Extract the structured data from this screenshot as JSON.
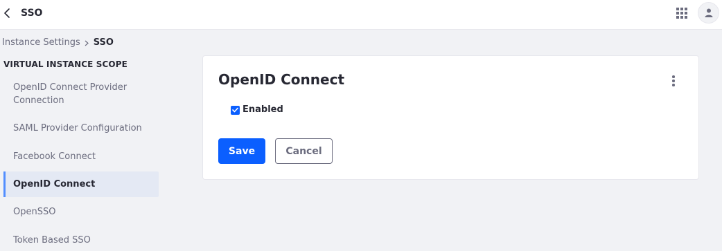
{
  "header": {
    "title": "SSO",
    "back_icon": "chevron-left-icon",
    "apps_icon": "grid-icon",
    "avatar_icon": "user-icon"
  },
  "breadcrumb": {
    "items": [
      "Instance Settings",
      "SSO"
    ]
  },
  "sidebar": {
    "scope_title": "VIRTUAL INSTANCE SCOPE",
    "items": [
      {
        "label": "OpenID Connect Provider Connection",
        "active": false
      },
      {
        "label": "SAML Provider Configuration",
        "active": false
      },
      {
        "label": "Facebook Connect",
        "active": false
      },
      {
        "label": "OpenID Connect",
        "active": true
      },
      {
        "label": "OpenSSO",
        "active": false
      },
      {
        "label": "Token Based SSO",
        "active": false
      }
    ]
  },
  "panel": {
    "title": "OpenID Connect",
    "menu_icon": "ellipsis-vertical-icon",
    "enabled_label": "Enabled",
    "enabled_checked": true,
    "save_label": "Save",
    "cancel_label": "Cancel"
  },
  "colors": {
    "primary": "#0b5fff",
    "active_nav_bg": "#e4e9f4",
    "active_nav_border": "#528eff",
    "page_bg": "#f1f2f5",
    "muted_text": "#6b6c7e"
  }
}
